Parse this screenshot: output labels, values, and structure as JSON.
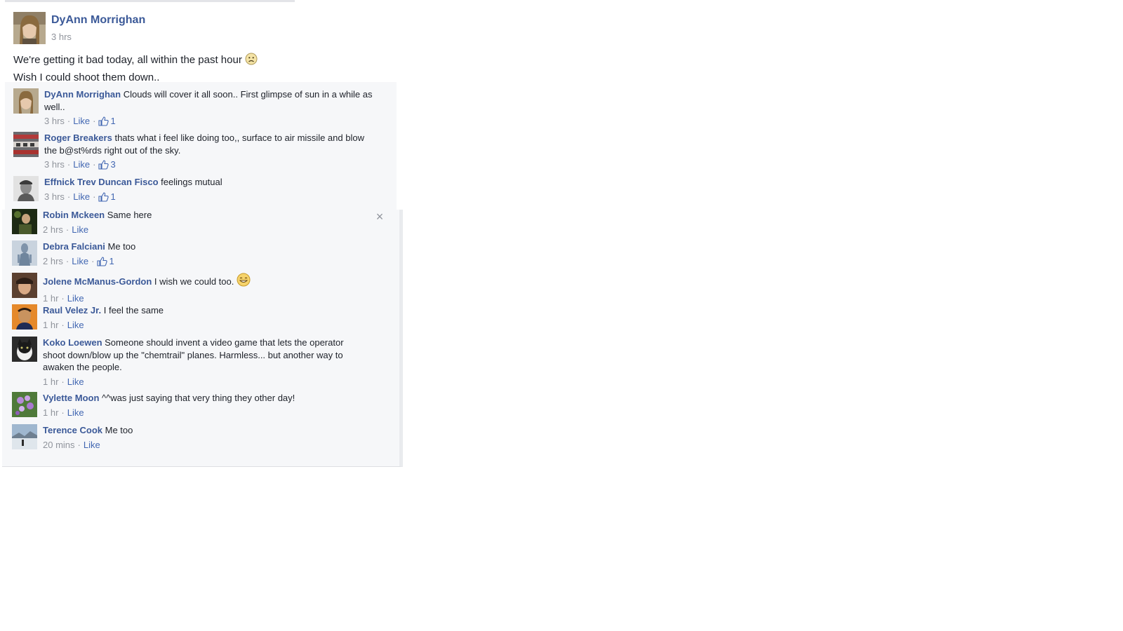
{
  "post": {
    "author": "DyAnn Morrighan",
    "time": "3 hrs",
    "text_line1": "We're getting it bad today, all within the past hour",
    "text_line2": "Wish I could shoot them down..",
    "emoji": "sad-face-icon"
  },
  "comments": [
    {
      "name": "DyAnn Morrighan",
      "text": "Clouds will cover it all soon.. First glimpse of sun in a while as well..",
      "time": "3 hrs",
      "like": "Like",
      "likes": "1"
    },
    {
      "name": "Roger Breakers",
      "text": "thats what i feel like doing too,, surface to air missile and blow the b@st%rds right out of the sky.",
      "time": "3 hrs",
      "like": "Like",
      "likes": "3"
    },
    {
      "name": "Effnick Trev Duncan Fisco",
      "text": "feelings mutual",
      "time": "3 hrs",
      "like": "Like",
      "likes": "1"
    },
    {
      "name": "Robin Mckeen",
      "text": "Same here",
      "time": "2 hrs",
      "like": "Like"
    },
    {
      "name": "Debra Falciani",
      "text": "Me too",
      "time": "2 hrs",
      "like": "Like",
      "likes": "1"
    },
    {
      "name": "Jolene McManus-Gordon",
      "text": "I wish we could too.",
      "time": "1 hr",
      "like": "Like",
      "emoji": "grin-face-icon"
    },
    {
      "name": "Raul Velez Jr.",
      "text": "I feel the same",
      "time": "1 hr",
      "like": "Like"
    },
    {
      "name": "Koko Loewen",
      "text": "Someone should invent a video game that lets the operator shoot down/blow up the \"chemtrail\" planes. Harmless... but another way to awaken the people.",
      "time": "1 hr",
      "like": "Like"
    },
    {
      "name": "Vylette Moon",
      "text": "^^was just saying that very thing they other day!",
      "time": "1 hr",
      "like": "Like"
    },
    {
      "name": "Terence Cook",
      "text": "Me too",
      "time": "20 mins",
      "like": "Like"
    }
  ],
  "close_icon": "close-icon",
  "colors": {
    "link": "#3b5998",
    "meta": "#90949c",
    "panel": "#f6f7f9"
  }
}
